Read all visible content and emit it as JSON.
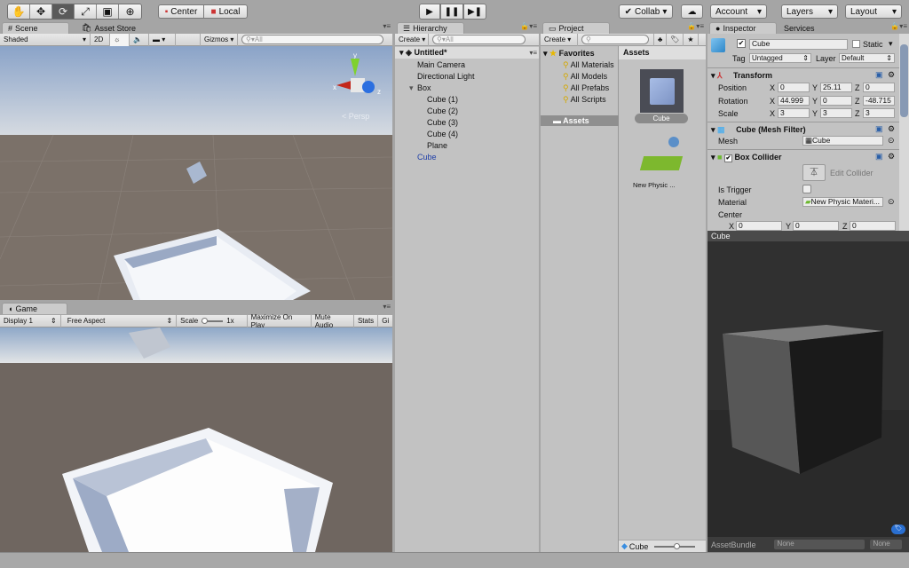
{
  "toolbar": {
    "tools": [
      "hand-tool",
      "move-tool",
      "rotate-tool",
      "scale-tool",
      "rect-tool",
      "transform-tool"
    ],
    "active_tool": "rotate-tool",
    "pivot": "Center",
    "space": "Local",
    "collab": "Collab",
    "account": "Account",
    "layers": "Layers",
    "layout": "Layout"
  },
  "scene": {
    "tab": "Scene",
    "asset_store_tab": "Asset Store",
    "shading": "Shaded",
    "mode_2d": "2D",
    "gizmos": "Gizmos",
    "search_placeholder": "All",
    "persp": "Persp",
    "axes": {
      "x": "x",
      "y": "y",
      "z": "z"
    }
  },
  "game": {
    "tab": "Game",
    "display": "Display 1",
    "aspect": "Free Aspect",
    "scale_label": "Scale",
    "scale_value": "1x",
    "maximize": "Maximize On Play",
    "mute": "Mute Audio",
    "stats": "Stats",
    "gizmos": "Gi"
  },
  "hierarchy": {
    "tab": "Hierarchy",
    "create": "Create",
    "search_placeholder": "All",
    "scene_name": "Untitled*",
    "items": [
      {
        "label": "Main Camera",
        "depth": 1
      },
      {
        "label": "Directional Light",
        "depth": 1
      },
      {
        "label": "Box",
        "depth": 1,
        "expanded": true
      },
      {
        "label": "Cube (1)",
        "depth": 2
      },
      {
        "label": "Cube (2)",
        "depth": 2
      },
      {
        "label": "Cube (3)",
        "depth": 2
      },
      {
        "label": "Cube (4)",
        "depth": 2
      },
      {
        "label": "Plane",
        "depth": 2
      },
      {
        "label": "Cube",
        "depth": 1,
        "selected": true
      }
    ]
  },
  "project": {
    "tab": "Project",
    "create": "Create",
    "favorites": "Favorites",
    "favorite_items": [
      "All Materials",
      "All Models",
      "All Prefabs",
      "All Scripts"
    ],
    "assets_folder": "Assets",
    "assets_header": "Assets",
    "assets": [
      {
        "label": "Cube",
        "selected": true
      },
      {
        "label": "New Physic ..."
      }
    ],
    "footer_selected": "Cube"
  },
  "inspector": {
    "tab": "Inspector",
    "services_tab": "Services",
    "object_name": "Cube",
    "active": true,
    "static_label": "Static",
    "static": false,
    "tag_label": "Tag",
    "tag": "Untagged",
    "layer_label": "Layer",
    "layer": "Default",
    "transform": {
      "title": "Transform",
      "position_label": "Position",
      "rotation_label": "Rotation",
      "scale_label": "Scale",
      "position": {
        "x": "0",
        "y": "25.11",
        "z": "0"
      },
      "rotation": {
        "x": "44.999",
        "y": "0",
        "z": "-48.715"
      },
      "scale": {
        "x": "3",
        "y": "3",
        "z": "3"
      }
    },
    "mesh_filter": {
      "title": "Cube (Mesh Filter)",
      "mesh_label": "Mesh",
      "mesh": "Cube"
    },
    "box_collider": {
      "title": "Box Collider",
      "enabled": true,
      "edit_collider": "Edit Collider",
      "is_trigger_label": "Is Trigger",
      "is_trigger": false,
      "material_label": "Material",
      "material": "New Physic Materi...",
      "center_label": "Center",
      "center": {
        "x": "0",
        "y": "0",
        "z": "0"
      }
    },
    "preview_title": "Cube",
    "asset_bundle_label": "AssetBundle",
    "asset_bundle": "None",
    "asset_bundle_variant": "None"
  },
  "colors": {
    "selected_text": "#1f3fa8",
    "panel_bg": "#c2c2c2",
    "preview_bg": "#2f2f2f"
  }
}
